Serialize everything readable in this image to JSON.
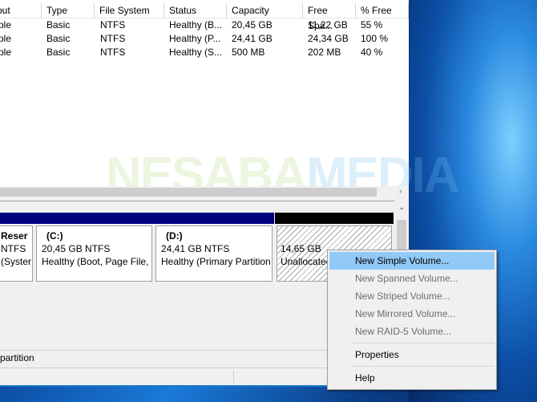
{
  "watermark": "NESABAMEDIA",
  "volume_table": {
    "headers": [
      "out",
      "Type",
      "File System",
      "Status",
      "Capacity",
      "Free Spa...",
      "% Free"
    ],
    "rows": [
      [
        "ple",
        "Basic",
        "NTFS",
        "Healthy (B...",
        "20,45 GB",
        "11,22 GB",
        "55 %"
      ],
      [
        "ple",
        "Basic",
        "NTFS",
        "Healthy (P...",
        "24,41 GB",
        "24,34 GB",
        "100 %"
      ],
      [
        "ple",
        "Basic",
        "NTFS",
        "Healthy (S...",
        "500 MB",
        "202 MB",
        "40 %"
      ]
    ]
  },
  "partitions": [
    {
      "name": "Reser",
      "line2": "NTFS",
      "line3": "(Syster"
    },
    {
      "name": "(C:)",
      "line2": "20,45 GB NTFS",
      "line3": "Healthy (Boot, Page File, C"
    },
    {
      "name": "(D:)",
      "line2": "24,41 GB NTFS",
      "line3": "Healthy (Primary Partition"
    },
    {
      "name": "",
      "line2": "14,65 GB",
      "line3": "Unallocated"
    }
  ],
  "legend": {
    "label": "partition"
  },
  "context_menu": {
    "items": [
      {
        "label": "New Simple Volume...",
        "enabled": true,
        "highlighted": true
      },
      {
        "label": "New Spanned Volume...",
        "enabled": false
      },
      {
        "label": "New Striped Volume...",
        "enabled": false
      },
      {
        "label": "New Mirrored Volume...",
        "enabled": false
      },
      {
        "label": "New RAID-5 Volume...",
        "enabled": false
      },
      {
        "label": "Properties",
        "enabled": true
      },
      {
        "label": "Help",
        "enabled": true
      }
    ]
  },
  "colors": {
    "partition_bar": "#00007f",
    "unallocated_bar": "#000000",
    "menu_highlight": "#91c9f7"
  }
}
